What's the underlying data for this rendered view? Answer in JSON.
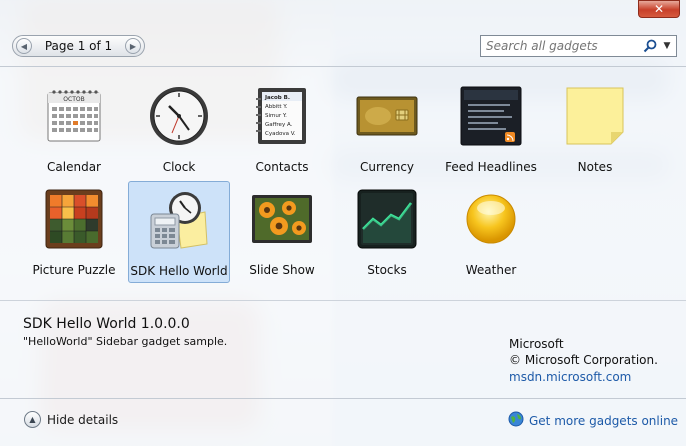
{
  "window": {
    "close_glyph": "✕"
  },
  "toolbar": {
    "pager_text": "Page 1 of 1",
    "search_placeholder": "Search all gadgets"
  },
  "gadgets": [
    {
      "label": "Calendar",
      "icon": "calendar-icon",
      "icon_text": "OCTOB"
    },
    {
      "label": "Clock",
      "icon": "clock-icon"
    },
    {
      "label": "Contacts",
      "icon": "contacts-icon",
      "entries": [
        "Jacob B.",
        "Abbitt Y.",
        "Simur Y.",
        "Gaffrey A.",
        "Cyadova V."
      ]
    },
    {
      "label": "Currency",
      "icon": "currency-icon"
    },
    {
      "label": "Feed Headlines",
      "icon": "feed-headlines-icon"
    },
    {
      "label": "Notes",
      "icon": "notes-icon"
    },
    {
      "label": "Picture Puzzle",
      "icon": "picture-puzzle-icon"
    },
    {
      "label": "SDK Hello World",
      "icon": "sdk-hello-world-icon",
      "selected": true
    },
    {
      "label": "Slide Show",
      "icon": "slide-show-icon"
    },
    {
      "label": "Stocks",
      "icon": "stocks-icon"
    },
    {
      "label": "Weather",
      "icon": "weather-icon"
    }
  ],
  "details": {
    "title": "SDK Hello World 1.0.0.0",
    "description": "\"HelloWorld\" Sidebar gadget sample.",
    "publisher": "Microsoft",
    "copyright": "© Microsoft Corporation.",
    "website": "msdn.microsoft.com"
  },
  "footer": {
    "hide_details_label": "Hide details",
    "get_more_label": "Get more gadgets online"
  }
}
